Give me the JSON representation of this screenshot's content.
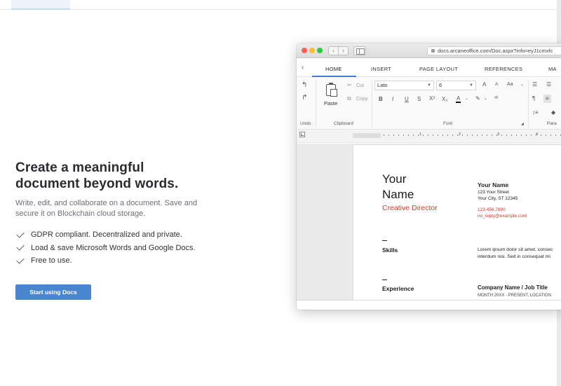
{
  "hero": {
    "title_line1": "Create a meaningful",
    "title_line2": "document beyond words.",
    "description": "Write, edit, and collaborate on a document. Save and secure it on Blockchain cloud storage.",
    "features": [
      "GDPR compliant. Decentralized and private.",
      "Load & save Microsoft Words and Google Docs.",
      "Free to use."
    ],
    "cta_label": "Start using Docs"
  },
  "browser": {
    "url": "docs.arcaneoffice.com/Doc.aspx?info=eyJ1cmxfc",
    "tabs": [
      "HOME",
      "INSERT",
      "PAGE LAYOUT",
      "REFERENCES",
      "MA"
    ],
    "active_tab": "HOME",
    "toolbar": {
      "undo_label": "Undo",
      "clipboard_label": "Clipboard",
      "font_label": "Font",
      "paragraph_label": "Para",
      "paste_label": "Paste",
      "cut_label": "Cut",
      "copy_label": "Copy",
      "font_family": "Lato",
      "font_size": "6",
      "bold": "B",
      "italic": "I",
      "underline": "U",
      "strike": "S",
      "grow": "A",
      "shrink": "A",
      "case": "Aa",
      "font_color": "A"
    },
    "ruler_numbers": [
      "1",
      "2",
      "3",
      "4"
    ]
  },
  "document": {
    "name_line1": "Your",
    "name_line2": "Name",
    "role": "Creative Director",
    "contact_name": "Your Name",
    "address1": "123 Your Street",
    "address2": "Your City, ST 12345",
    "phone": "123.456.7890",
    "email": "no_reply@example.com",
    "skills_title": "Skills",
    "skills_text1": "Lorem ipsum dolor sit amet, consec",
    "skills_text2": "interdum nisi. Sed in consequat mi",
    "experience_title": "Experience",
    "experience_job": "Company Name / Job Title",
    "experience_dates": "MONTH 20XX - PRESENT, LOCATION"
  },
  "colors": {
    "accent": "#4a86cf",
    "ribbon_active": "#3b7ddd",
    "resume_red": "#d93a2b"
  }
}
